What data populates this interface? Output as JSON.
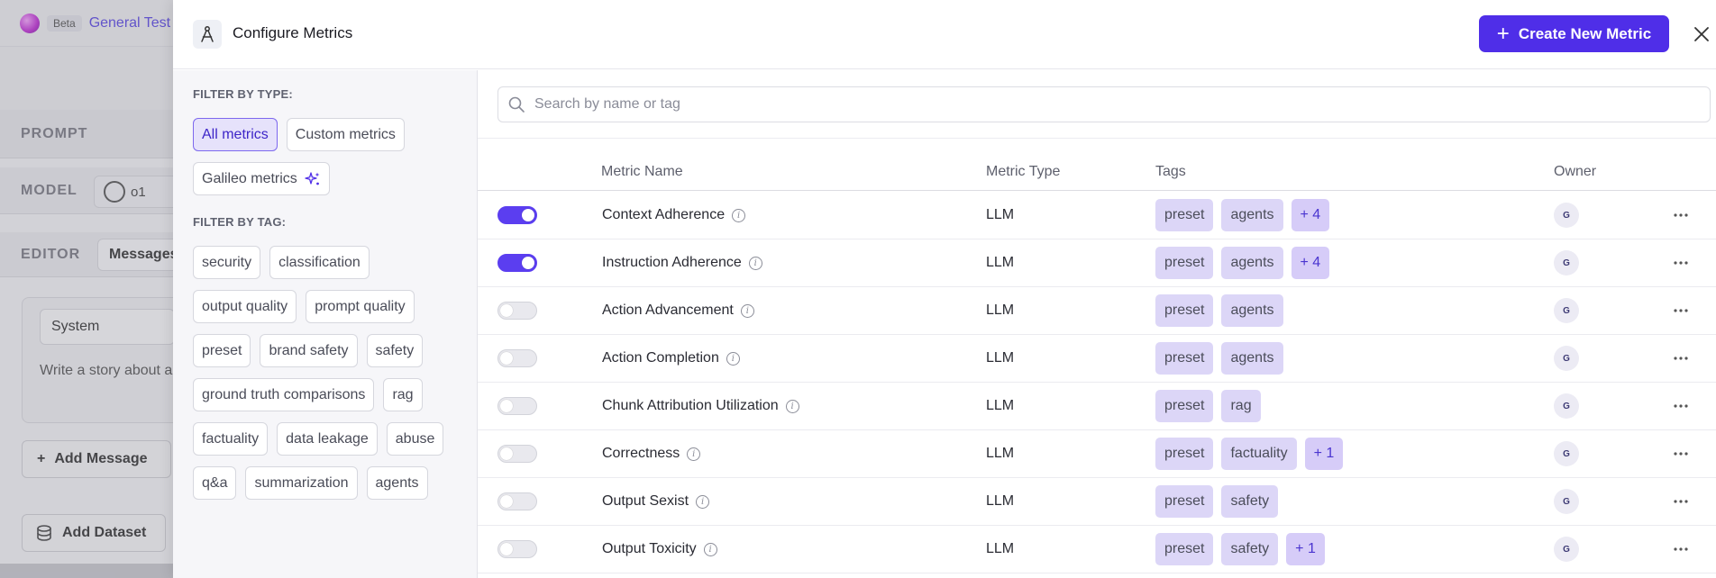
{
  "background": {
    "beta_label": "Beta",
    "project_name": "General Test",
    "prompt_label": "PROMPT",
    "model_label": "MODEL",
    "model_value": "o1",
    "editor_label": "EDITOR",
    "messages_tab": "Messages",
    "role_value": "System",
    "message_text": "Write a story about a",
    "add_message": "Add Message",
    "add_dataset": "Add Dataset"
  },
  "modal": {
    "title": "Configure Metrics",
    "create_button": "Create New Metric",
    "filters": {
      "type_heading": "FILTER BY TYPE:",
      "types": [
        {
          "label": "All metrics",
          "active": true
        },
        {
          "label": "Custom metrics",
          "active": false
        },
        {
          "label": "Galileo metrics",
          "active": false
        }
      ],
      "tag_heading": "FILTER BY TAG:",
      "tags": [
        "security",
        "classification",
        "output quality",
        "prompt quality",
        "preset",
        "brand safety",
        "safety",
        "ground truth comparisons",
        "rag",
        "factuality",
        "data leakage",
        "abuse",
        "q&a",
        "summarization",
        "agents"
      ]
    },
    "search": {
      "placeholder": "Search by name or tag",
      "value": ""
    },
    "table": {
      "columns": {
        "name": "Metric Name",
        "type": "Metric Type",
        "tags": "Tags",
        "owner": "Owner"
      },
      "rows": [
        {
          "enabled": true,
          "name": "Context Adherence",
          "type": "LLM",
          "tags": [
            "preset",
            "agents"
          ],
          "more": "+ 4",
          "owner": "G"
        },
        {
          "enabled": true,
          "name": "Instruction Adherence",
          "type": "LLM",
          "tags": [
            "preset",
            "agents"
          ],
          "more": "+ 4",
          "owner": "G"
        },
        {
          "enabled": false,
          "name": "Action Advancement",
          "type": "LLM",
          "tags": [
            "preset",
            "agents"
          ],
          "more": "",
          "owner": "G"
        },
        {
          "enabled": false,
          "name": "Action Completion",
          "type": "LLM",
          "tags": [
            "preset",
            "agents"
          ],
          "more": "",
          "owner": "G"
        },
        {
          "enabled": false,
          "name": "Chunk Attribution Utilization",
          "type": "LLM",
          "tags": [
            "preset",
            "rag"
          ],
          "more": "",
          "owner": "G"
        },
        {
          "enabled": false,
          "name": "Correctness",
          "type": "LLM",
          "tags": [
            "preset",
            "factuality"
          ],
          "more": "+ 1",
          "owner": "G"
        },
        {
          "enabled": false,
          "name": "Output Sexist",
          "type": "LLM",
          "tags": [
            "preset",
            "safety"
          ],
          "more": "",
          "owner": "G"
        },
        {
          "enabled": false,
          "name": "Output Toxicity",
          "type": "LLM",
          "tags": [
            "preset",
            "safety"
          ],
          "more": "+ 1",
          "owner": "G"
        }
      ]
    }
  },
  "colors": {
    "accent": "#4f2ee8",
    "tag_bg": "#dcd6f7",
    "toggle_on": "#5b3ef0"
  },
  "icons": {
    "header": "compass-icon",
    "close": "close-icon",
    "search": "search-icon",
    "info": "info-icon",
    "sparkle": "sparkle-icon",
    "menu": "more-horizontal-icon"
  }
}
